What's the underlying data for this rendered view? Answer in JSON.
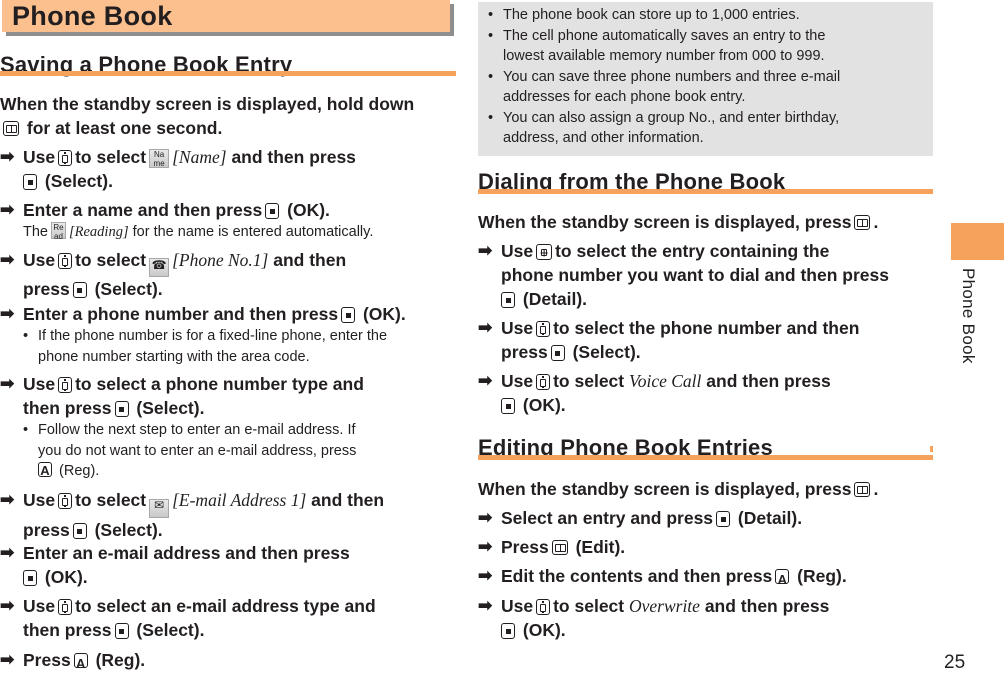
{
  "chapter": {
    "title": "Phone Book",
    "side_label": "Phone Book",
    "page_number": "25"
  },
  "colors": {
    "banner": "#fbc08e",
    "accent": "#f6a25d",
    "info_box": "#e2e2e2",
    "text": "#231f20"
  },
  "saving": {
    "heading": "Saving a Phone Book Entry",
    "intro_1": "When the standby screen is displayed, hold down",
    "intro_2": "for at least one second.",
    "steps": [
      {
        "a": "Use",
        "b": "to select",
        "icon_label_1": "Na",
        "icon_label_2": "me",
        "item": "[Name]",
        "c": "and then press",
        "d": "(Select)."
      },
      {
        "a": "Enter a name and then press",
        "b": "(OK).",
        "note_a": "The",
        "icon_label_1": "Re",
        "icon_label_2": "ad",
        "note_item": "[Reading]",
        "note_b": "for the name is entered automatically."
      },
      {
        "a": "Use",
        "b": "to select",
        "item": "[Phone No.1]",
        "c": "and then",
        "d": "press",
        "e": "(Select)."
      },
      {
        "a": "Enter a phone number and then press",
        "b": "(OK).",
        "note_1": "If the phone number is for a fixed-line phone, enter the",
        "note_2": "phone number starting with the area code."
      },
      {
        "a": "Use",
        "b": "to select a phone number type and",
        "c": "then press",
        "d": "(Select).",
        "note_1": "Follow the next step to enter an e-mail address. If",
        "note_2": "you do not want to enter an e-mail address, press",
        "note_3": "(Reg)."
      },
      {
        "a": "Use",
        "b": "to select",
        "item": "[E-mail Address 1]",
        "c": "and then",
        "d": "press",
        "e": "(Select)."
      },
      {
        "a": "Enter an e-mail address and then press",
        "b": "(OK)."
      },
      {
        "a": "Use",
        "b": "to select an e-mail address type and",
        "c": "then press",
        "d": "(Select)."
      },
      {
        "a": "Press",
        "b": "(Reg)."
      }
    ]
  },
  "info_notes": [
    {
      "line_1": "The phone book can store up to 1,000 entries."
    },
    {
      "line_1": "The cell phone automatically saves an entry to the",
      "line_2": "lowest available memory number from 000 to 999."
    },
    {
      "line_1": "You can save three phone numbers and three e-mail",
      "line_2": "addresses for each phone book entry."
    },
    {
      "line_1": "You can also assign a group No., and enter birthday,",
      "line_2": "address, and other information."
    }
  ],
  "bullet": "•",
  "arrow": "➡",
  "dialing": {
    "heading": "Dialing from the Phone Book",
    "intro": "When the standby screen is displayed, press",
    "steps": [
      {
        "a": "Use",
        "b": "to select the entry containing the",
        "c": "phone number you want to dial and then press",
        "d": "(Detail)."
      },
      {
        "a": "Use",
        "b": "to select the phone number and then",
        "c": "press",
        "d": "(Select)."
      },
      {
        "a": "Use",
        "b": "to select",
        "item": "Voice Call",
        "c": "and then press",
        "d": "(OK)."
      }
    ]
  },
  "editing": {
    "heading": "Editing Phone Book Entries",
    "intro": "When the standby screen is displayed, press",
    "steps": [
      {
        "a": "Select an entry and press",
        "b": "(Detail)."
      },
      {
        "a": "Press",
        "b": "(Edit)."
      },
      {
        "a": "Edit the contents and then press",
        "b": "(Reg)."
      },
      {
        "a": "Use",
        "b": "to select",
        "item": "Overwrite",
        "c": "and then press",
        "d": "(OK)."
      }
    ]
  }
}
